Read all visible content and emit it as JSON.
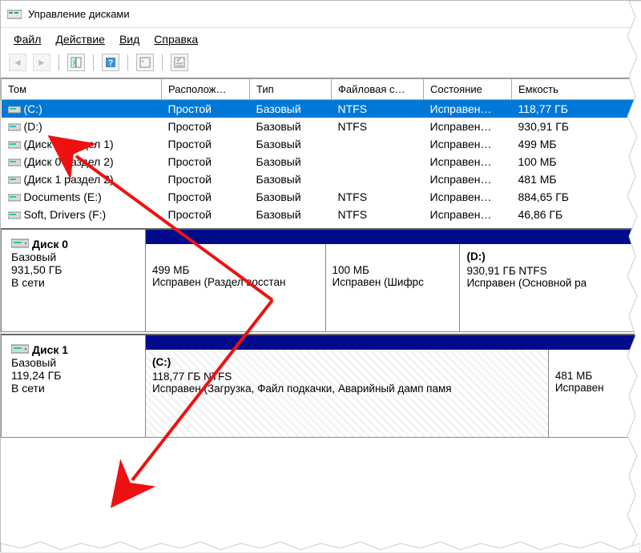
{
  "window": {
    "title": "Управление дисками"
  },
  "menu": {
    "file": "Файл",
    "action": "Действие",
    "view": "Вид",
    "help": "Справка"
  },
  "columns": {
    "volume": "Том",
    "layout": "Располож…",
    "type": "Тип",
    "fs": "Файловая с…",
    "status": "Состояние",
    "capacity": "Емкость"
  },
  "volumes": [
    {
      "name": "(C:)",
      "layout": "Простой",
      "type": "Базовый",
      "fs": "NTFS",
      "status": "Исправен…",
      "capacity": "118,77 ГБ",
      "selected": true
    },
    {
      "name": "(D:)",
      "layout": "Простой",
      "type": "Базовый",
      "fs": "NTFS",
      "status": "Исправен…",
      "capacity": "930,91 ГБ"
    },
    {
      "name": "(Диск 0 раздел 1)",
      "layout": "Простой",
      "type": "Базовый",
      "fs": "",
      "status": "Исправен…",
      "capacity": "499 МБ"
    },
    {
      "name": "(Диск 0 раздел 2)",
      "layout": "Простой",
      "type": "Базовый",
      "fs": "",
      "status": "Исправен…",
      "capacity": "100 МБ"
    },
    {
      "name": "(Диск 1 раздел 2)",
      "layout": "Простой",
      "type": "Базовый",
      "fs": "",
      "status": "Исправен…",
      "capacity": "481 МБ"
    },
    {
      "name": "Documents (E:)",
      "layout": "Простой",
      "type": "Базовый",
      "fs": "NTFS",
      "status": "Исправен…",
      "capacity": "884,65 ГБ"
    },
    {
      "name": "Soft, Drivers (F:)",
      "layout": "Простой",
      "type": "Базовый",
      "fs": "NTFS",
      "status": "Исправен…",
      "capacity": "46,86 ГБ"
    }
  ],
  "disks": [
    {
      "name": "Диск 0",
      "type": "Базовый",
      "size": "931,50 ГБ",
      "status": "В сети",
      "partitions": [
        {
          "label": "",
          "size": "499 МБ",
          "desc": "Исправен (Раздел восстан",
          "flex": 22
        },
        {
          "label": "",
          "size": "100 МБ",
          "desc": "Исправен (Шифрс",
          "flex": 16
        },
        {
          "label": "(D:)",
          "size": "930,91 ГБ NTFS",
          "desc": "Исправен (Основной ра",
          "flex": 22
        }
      ]
    },
    {
      "name": "Диск 1",
      "type": "Базовый",
      "size": "119,24 ГБ",
      "status": "В сети",
      "partitions": [
        {
          "label": "(C:)",
          "size": "118,77 ГБ NTFS",
          "desc": "Исправен (Загрузка, Файл подкачки, Аварийный дамп памя",
          "flex": 50,
          "hatched": true
        },
        {
          "label": "",
          "size": "481 МБ",
          "desc": "Исправен",
          "flex": 10
        }
      ]
    }
  ]
}
